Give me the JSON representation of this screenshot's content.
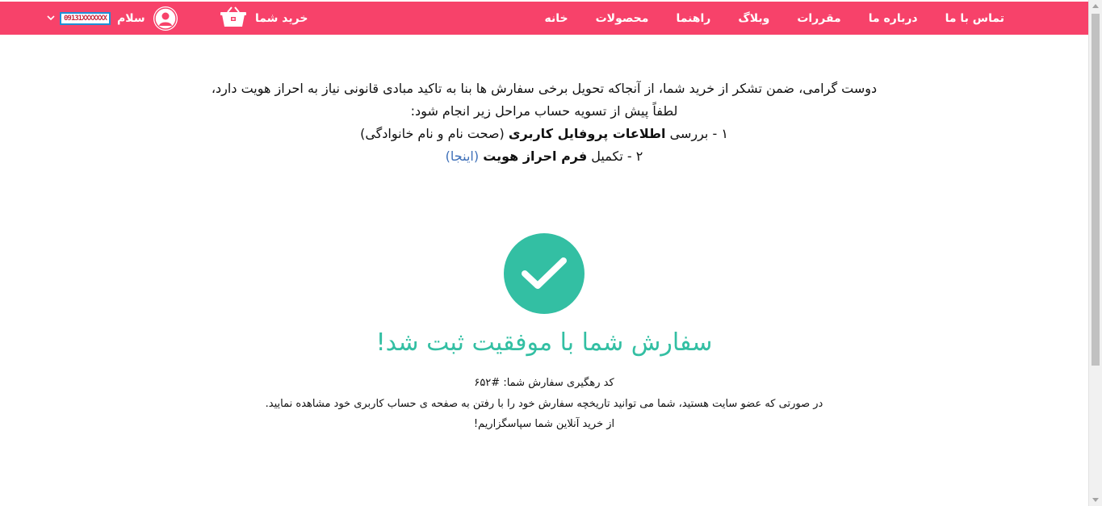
{
  "nav": {
    "items": [
      "خانه",
      "محصولات",
      "راهنما",
      "وبلاگ",
      "مقررات",
      "درباره ما",
      "تماس با ما"
    ],
    "cart_label": "خرید شما",
    "greeting": "سلام",
    "username": "09131XXXXXXX",
    "bar_color": "#f7426a"
  },
  "notice": {
    "line1": "دوست گرامی، ضمن تشکر از خرید شما، از آنجاکه تحویل برخی سفارش ها بنا به تاکید مبادی قانونی نیاز به احراز هویت دارد،",
    "line2": "لطفاً پیش از تسویه حساب مراحل زیر انجام شود:",
    "step1_prefix": "۱ - بررسی ",
    "step1_bold": "اطلاعات پروفایل کاربری",
    "step1_suffix": " (صحت نام و نام خانوادگی)",
    "step2_prefix": "۲ - تکمیل ",
    "step2_bold": "فرم احراز هویت",
    "step2_link": "(اینجا)"
  },
  "success": {
    "title": "سفارش شما با موفقیت ثبت شد!",
    "tracking": "کد رهگیری سفارش شما: #۶۵۲",
    "info": "در صورتی که عضو سایت هستید، شما می توانید تاریخچه سفارش خود را با رفتن به صفحه ی حساب کاربری خود مشاهده نمایید.",
    "thanks": "از خرید آنلاین شما سپاسگزاریم!",
    "accent_color": "#33bfa3"
  }
}
